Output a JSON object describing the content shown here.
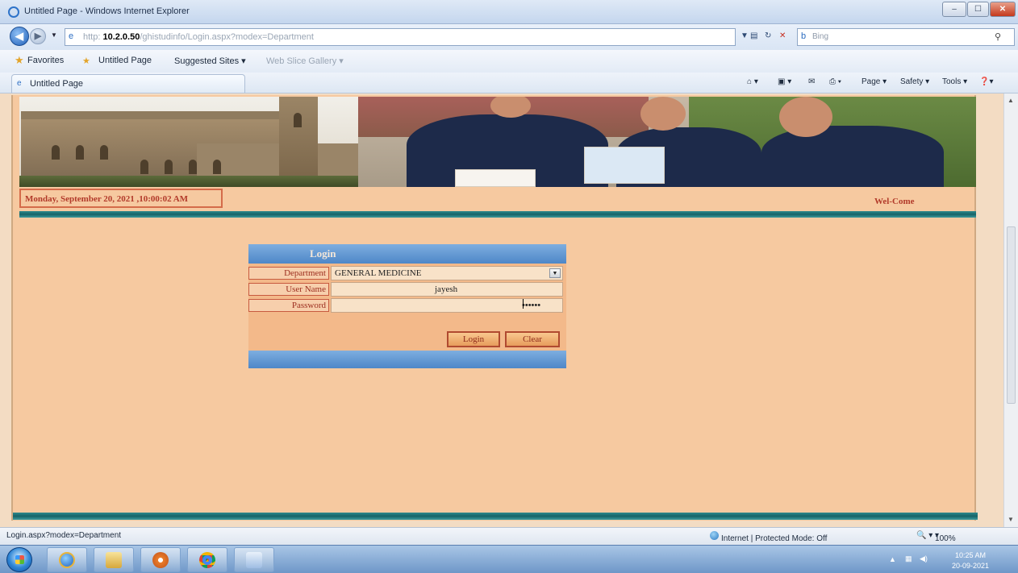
{
  "window": {
    "title": "Untitled Page - Windows Internet Explorer",
    "min": "–",
    "max": "☐",
    "close": "✕"
  },
  "address": {
    "url_prefix": "http:",
    "url_host": "10.2.0.50",
    "url_path": "/ghistudinfo/Login.aspx?modex=Department",
    "search_placeholder": "Bing"
  },
  "favorites": {
    "label": "Favorites",
    "items": [
      "Untitled Page",
      "Suggested Sites ▾",
      "Web Slice Gallery ▾"
    ]
  },
  "tab": {
    "label": "Untitled Page"
  },
  "commands": [
    "Page ▾",
    "Safety ▾",
    "Tools ▾"
  ],
  "page": {
    "datetime": "Monday, September 20, 2021 ,10:00:02 AM",
    "welcome": "Wel-Come"
  },
  "login": {
    "title": "Login",
    "department_label": "Department",
    "department_value": "GENERAL MEDICINE",
    "username_label": "User Name",
    "username_value": "jayesh",
    "password_label": "Password",
    "password_value": "••••••",
    "login_button": "Login",
    "clear_button": "Clear"
  },
  "status": {
    "left": "Login.aspx?modex=Department",
    "zone": "Internet | Protected Mode: Off",
    "zoom": "100%"
  },
  "tray": {
    "time": "10:25 AM",
    "date": "20-09-2021"
  },
  "colors": {
    "page_bg": "#f6c9a0",
    "accent_teal": "#176367",
    "label_red": "#b23a2a",
    "login_header_blue": "#4e87c8"
  }
}
